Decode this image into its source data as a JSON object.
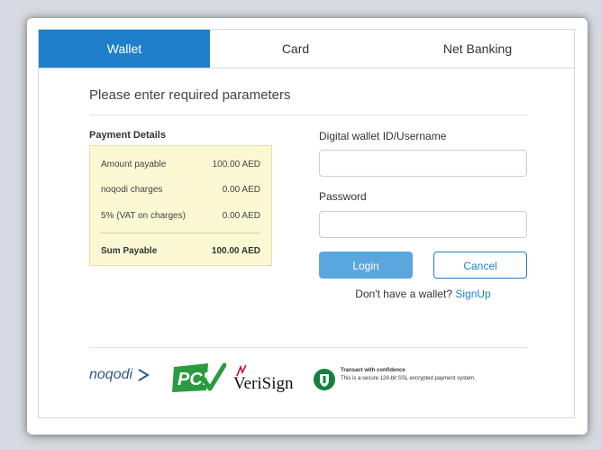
{
  "tabs": [
    {
      "label": "Wallet",
      "active": true
    },
    {
      "label": "Card",
      "active": false
    },
    {
      "label": "Net Banking",
      "active": false
    }
  ],
  "heading": "Please enter required parameters",
  "payment_details": {
    "title": "Payment Details",
    "rows": [
      {
        "label": "Amount payable",
        "value": "100.00 AED"
      },
      {
        "label": "noqodi charges",
        "value": "0.00 AED"
      },
      {
        "label": "5% (VAT on charges)",
        "value": "0.00 AED"
      }
    ],
    "total": {
      "label": "Sum Payable",
      "value": "100.00 AED"
    }
  },
  "form": {
    "wallet_label": "Digital wallet ID/Username",
    "wallet_value": "",
    "password_label": "Password",
    "password_value": "",
    "login_label": "Login",
    "cancel_label": "Cancel",
    "signup_prompt": "Don't have a wallet?",
    "signup_link": "SignUp"
  },
  "footer": {
    "noqodi": "noqodi",
    "pci": "PCI",
    "verisign": "VeriSign",
    "ssl_title": "Transact with confidence",
    "ssl_text": "This is a secure 128-bit SSL encrypted payment system."
  },
  "colors": {
    "accent": "#1f7fcb",
    "login_button": "#5aa7de",
    "details_background": "#fbf9d4",
    "pci_green": "#2a9b3e",
    "verisign_red": "#c8102e",
    "shield_green": "#15803d"
  }
}
